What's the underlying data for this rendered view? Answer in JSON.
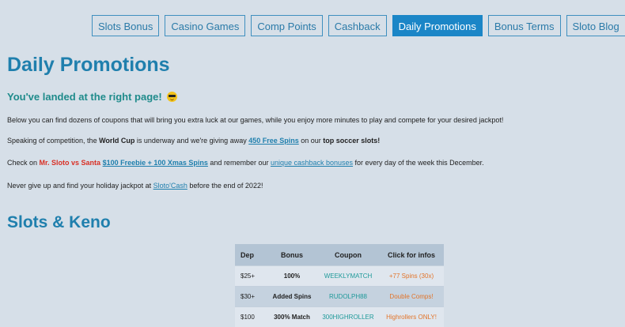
{
  "nav": {
    "items": [
      {
        "label": "Slots Bonus",
        "active": false
      },
      {
        "label": "Casino Games",
        "active": false
      },
      {
        "label": "Comp Points",
        "active": false
      },
      {
        "label": "Cashback",
        "active": false
      },
      {
        "label": "Daily Promotions",
        "active": true
      },
      {
        "label": "Bonus Terms",
        "active": false
      },
      {
        "label": "Sloto Blog",
        "active": false
      }
    ]
  },
  "main": {
    "title": "Daily Promotions",
    "subtitle": "You've landed at the right page!",
    "p1": "Below you can find dozens of coupons that will bring you extra luck at our games, while you enjoy more minutes to play and compete for your desired jackpot!",
    "p2": {
      "a": "Speaking of competition, the ",
      "b": "World Cup",
      "c": " is underway and we're giving away ",
      "link": "450 Free Spins",
      "d": " on our ",
      "e": "top soccer slots!"
    },
    "p3": {
      "a": "Check on ",
      "red": "Mr. Sloto vs Santa",
      "link": "$100 Freebie + 100 Xmas Spins",
      "b": " and remember our ",
      "link2": "unique cashback bonuses",
      "c": " for every day of the week this December."
    },
    "p4": {
      "a": "Never give up and find your holiday jackpot at ",
      "link": "Sloto'Cash",
      "b": " before the end of 2022!"
    },
    "section_title": "Slots & Keno"
  },
  "table": {
    "headers": {
      "dep": "Dep",
      "bonus": "Bonus",
      "coupon": "Coupon",
      "info": "Click for infos"
    },
    "rows": [
      {
        "dep": "$25+",
        "bonus": "100%",
        "coupon": "WEEKLYMATCH",
        "info": "+77 Spins (30x)"
      },
      {
        "dep": "$30+",
        "bonus": "Added Spins",
        "coupon": "RUDOLPH88",
        "info": "Double Comps!"
      },
      {
        "dep": "$100",
        "bonus": "300% Match",
        "coupon": "300HIGHROLLER",
        "info": "Highrollers ONLY!"
      }
    ]
  },
  "colors": {
    "background": "#d6dfe8",
    "accent": "#1f7fad",
    "nav_active": "#1b86c7",
    "coupon": "#1f9a9a",
    "info": "#e2742a",
    "red": "#d93025"
  }
}
